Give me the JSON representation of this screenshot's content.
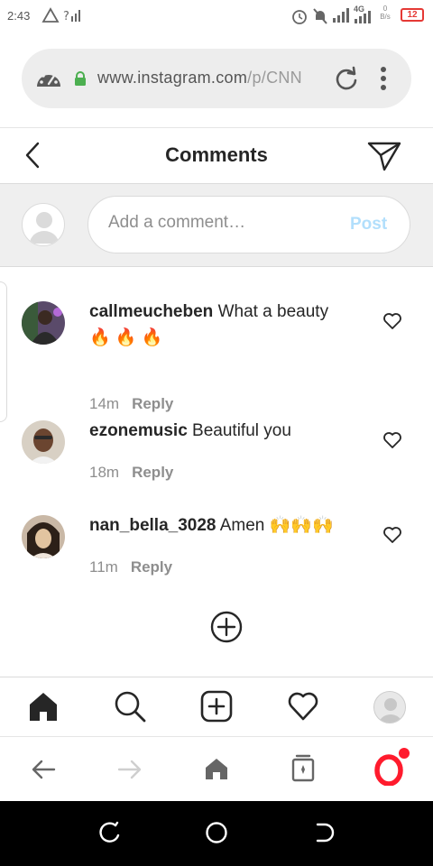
{
  "status_bar": {
    "time": "2:43",
    "network_label": "4G",
    "speed_value": "0",
    "speed_unit": "B/s",
    "battery": "12"
  },
  "browser": {
    "url_main": "www.instagram.com",
    "url_path": "/p/CNN"
  },
  "header": {
    "title": "Comments"
  },
  "compose": {
    "placeholder": "Add a comment…",
    "post_label": "Post"
  },
  "comments": [
    {
      "username": "callmeucheben",
      "text": "What a beauty",
      "emoji": "🔥 🔥 🔥",
      "time": "14m",
      "reply_label": "Reply"
    },
    {
      "username": "ezonemusic",
      "text": "Beautiful you",
      "emoji": "",
      "time": "18m",
      "reply_label": "Reply"
    },
    {
      "username": "nan_bella_3028",
      "text": "Amen",
      "emoji": "🙌🙌🙌",
      "time": "11m",
      "reply_label": "Reply"
    }
  ],
  "colors": {
    "accent_post_disabled": "#b2dffc",
    "secure_lock": "#4caf50",
    "opera_red": "#ff1b2d",
    "battery_red": "#e53935"
  },
  "icons": {
    "header": [
      "back-chevron-icon",
      "send-direct-icon"
    ],
    "ig_nav": [
      "home-icon",
      "search-icon",
      "new-post-icon",
      "activity-heart-icon",
      "profile-avatar"
    ],
    "browser_nav": [
      "back-arrow-icon",
      "forward-arrow-icon",
      "home-icon",
      "tabs-icon",
      "opera-menu-icon"
    ],
    "android_nav": [
      "recents-icon",
      "home-circle-icon",
      "back-icon"
    ]
  }
}
